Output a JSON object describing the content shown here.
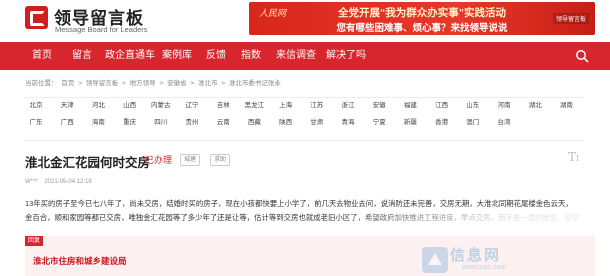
{
  "header": {
    "logo_cn": "领导留言板",
    "logo_en": "Message Board for Leaders",
    "banner": {
      "source": "人民网",
      "line1": "全党开展“我为群众办实事”实践活动",
      "line2": "您有哪些困难事、烦心事？来找领导说说",
      "brand": "领导留言板"
    }
  },
  "nav": {
    "items": [
      "首页",
      "留言",
      "政企直通车",
      "案例库",
      "反馈",
      "指数",
      "来信调查",
      "解决了吗"
    ]
  },
  "breadcrumb": [
    "当前位置：",
    "首页",
    ">",
    "领导留言板",
    ">",
    "地方领导",
    ">",
    "安徽省",
    ">",
    "淮北市",
    ">",
    "淮北市委书记张永"
  ],
  "regions": {
    "row1": [
      "北京",
      "天津",
      "河北",
      "山西",
      "内蒙古",
      "辽宁",
      "吉林",
      "黑龙江",
      "上海",
      "江苏",
      "浙江",
      "安徽",
      "福建",
      "江西",
      "山东",
      "河南",
      "湖北",
      "湖南"
    ],
    "row2": [
      "广东",
      "广西",
      "海南",
      "重庆",
      "四川",
      "贵州",
      "云南",
      "西藏",
      "陕西",
      "甘肃",
      "青海",
      "宁夏",
      "新疆",
      "香港",
      "澳门",
      "台湾"
    ]
  },
  "message": {
    "title": "淮北金汇花园何时交房",
    "status": "已办理",
    "tags": [
      "城建",
      "求助"
    ],
    "author": "W***",
    "date": "2021-05-04 12:18",
    "font_toggle": "T↕",
    "body": [
      "13年买的房子至今已七八年了，尚未交房，结婚时买的房子，现在小孩都快要上小学了，前几天去物业去问，说消防还未完善，交房无期，大淮北同期花尾楼金色云天，",
      "金百合，顺和家园等都已交房，唯独金汇花园等了多少年了还是让等，估计等到交房也就成老旧小区了，希望政府加快推进工程进度，早点交房，而不是一直的推脱，谢谢"
    ]
  },
  "reply": {
    "badge": "回复",
    "org": "淮北市住房和城乡建设局"
  },
  "watermark": {
    "text": "信息网",
    "url": "www.xqic.com"
  }
}
